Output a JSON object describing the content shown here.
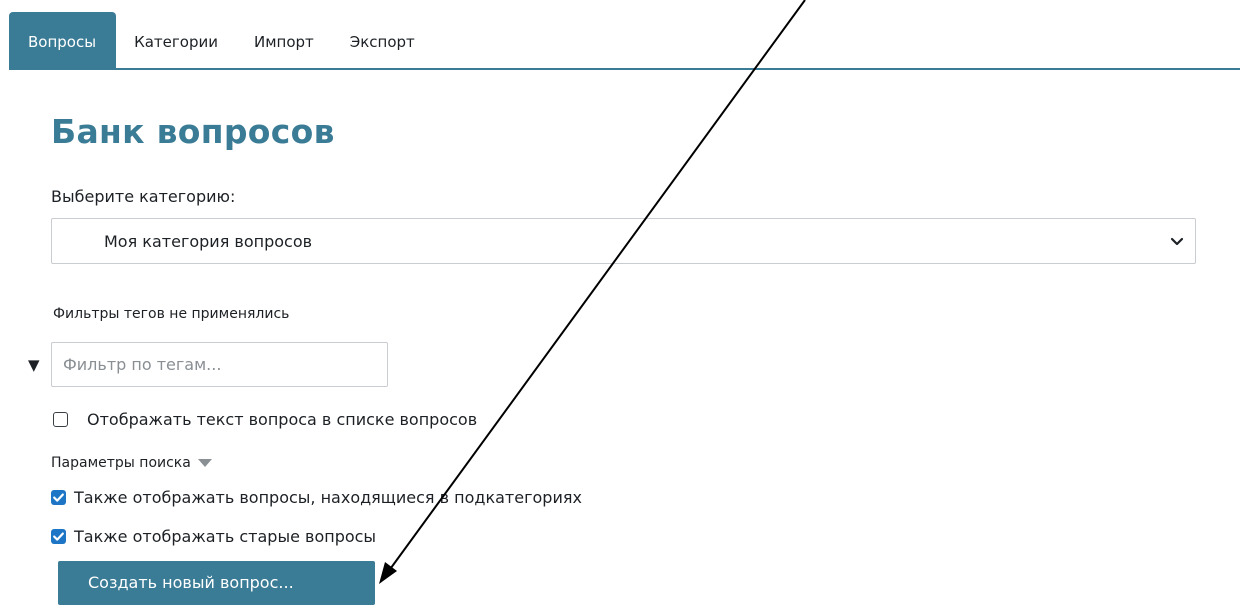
{
  "tabs": [
    {
      "label": "Вопросы",
      "active": true
    },
    {
      "label": "Категории",
      "active": false
    },
    {
      "label": "Импорт",
      "active": false
    },
    {
      "label": "Экспорт",
      "active": false
    }
  ],
  "page": {
    "title": "Банк вопросов",
    "category_label": "Выберите категорию:",
    "category_selected": "Моя категория вопросов",
    "tag_filter_note": "Фильтры тегов не применялись",
    "tag_toggle_glyph": "▼",
    "tag_filter_placeholder": "Фильтр по тегам...",
    "show_question_text": {
      "label": "Отображать текст вопроса в списке вопросов",
      "checked": false
    },
    "search_options_label": "Параметры поиска",
    "include_subcategories": {
      "label": "Также отображать вопросы, находящиеся в подкатегориях",
      "checked": true
    },
    "include_old": {
      "label": "Также отображать старые вопросы",
      "checked": true
    },
    "create_button": "Создать новый вопрос..."
  },
  "colors": {
    "accent": "#3a7b95",
    "checkbox_checked": "#1d76c5",
    "text": "#1d2125",
    "border": "#c9ccd0",
    "annotation_arrow": "#000000"
  },
  "icons": {
    "select_chevron": "chevron-down-icon",
    "search_caret": "caret-down-icon",
    "checkmark": "check-icon",
    "annotation": "arrow-icon"
  }
}
